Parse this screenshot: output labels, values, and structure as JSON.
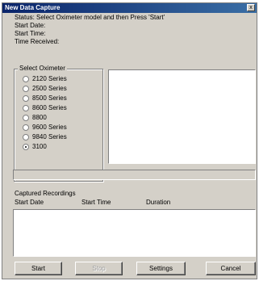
{
  "window": {
    "title": "New Data Capture",
    "close_glyph": "x"
  },
  "status": {
    "status_label": "Status:",
    "status_value": "Select Oximeter model and then Press 'Start'",
    "start_date_label": "Start Date:",
    "start_time_label": "Start Time:",
    "time_received_label": "Time Received:"
  },
  "oximeter": {
    "group_title": "Select Oximeter",
    "options": [
      {
        "label": "2120 Series",
        "checked": false
      },
      {
        "label": "2500 Series",
        "checked": false
      },
      {
        "label": "8500 Series",
        "checked": false
      },
      {
        "label": "8600 Series",
        "checked": false
      },
      {
        "label": "8800",
        "checked": false
      },
      {
        "label": "9600 Series",
        "checked": false
      },
      {
        "label": "9840 Series",
        "checked": false
      },
      {
        "label": "3100",
        "checked": true
      }
    ]
  },
  "recordings": {
    "title": "Captured Recordings",
    "columns": [
      "Start Date",
      "Start Time",
      "Duration"
    ]
  },
  "buttons": {
    "start": "Start",
    "stop": "Stop",
    "settings": "Settings",
    "cancel": "Cancel"
  },
  "colors": {
    "titlebar": "#0a246a",
    "face": "#d4d0c8"
  }
}
